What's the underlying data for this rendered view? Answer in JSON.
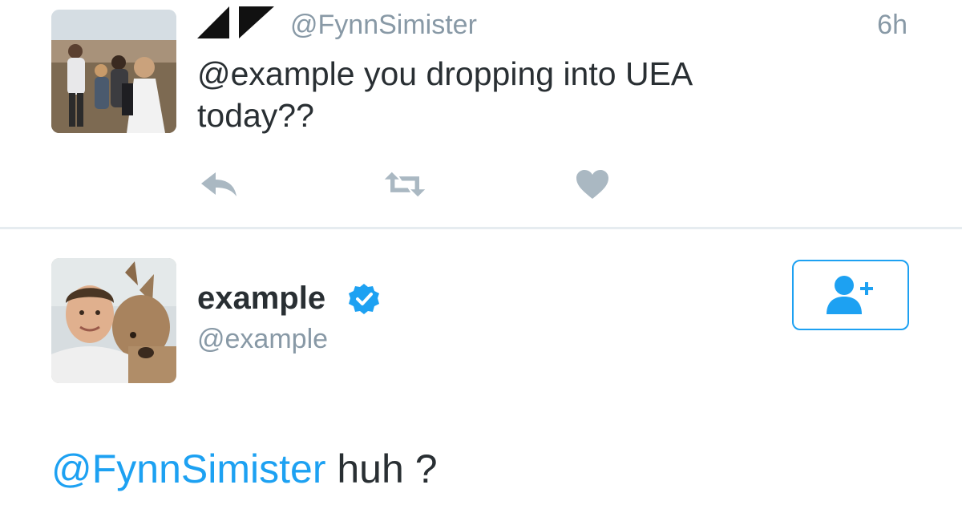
{
  "reply_tweet": {
    "handle": "@FynnSimister",
    "time": "6h",
    "text_line1": "@example you dropping into UEA",
    "text_line2": "today??",
    "actions": {
      "reply_icon": "reply-icon",
      "retweet_icon": "retweet-icon",
      "like_icon": "heart-icon"
    }
  },
  "original_tweet": {
    "display_name": "example",
    "handle": "@example",
    "verified": true,
    "follow_icon": "add-user-icon",
    "text_mention": "@FynnSimister",
    "text_body": " huh ?"
  },
  "colors": {
    "accent": "#1da1f2",
    "secondary_text": "#8899a6",
    "primary_text": "#292f33",
    "icon_gray": "#aab8c2",
    "divider": "#e6ecf0"
  }
}
